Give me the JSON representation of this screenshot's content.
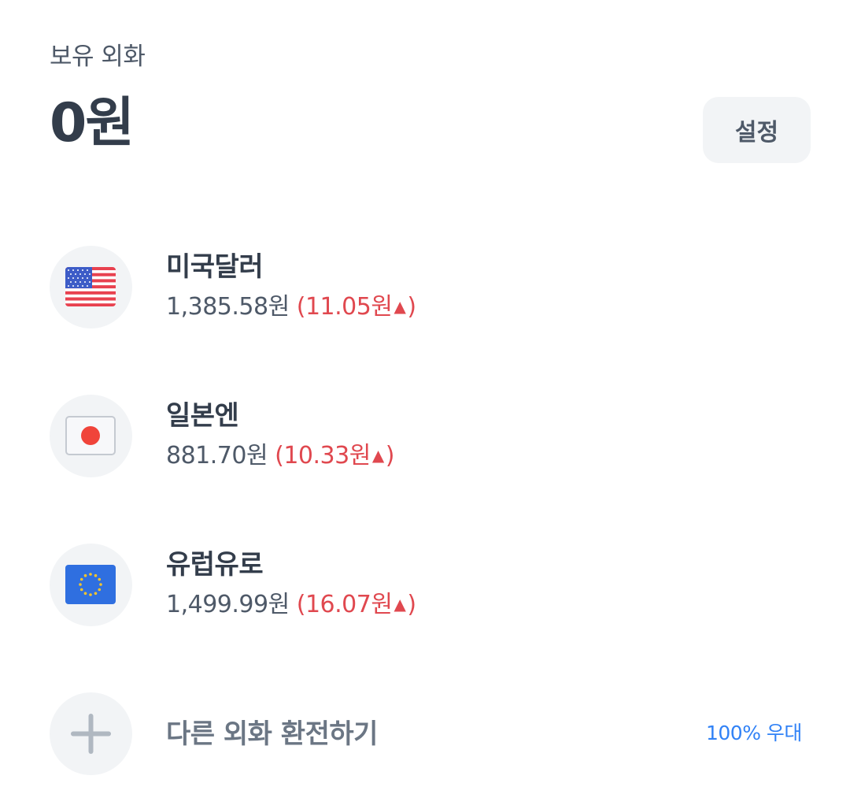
{
  "header": {
    "section_label": "보유 외화",
    "total_amount": "0원",
    "settings_label": "설정"
  },
  "currencies": [
    {
      "name": "미국달러",
      "rate": "1,385.58원",
      "change_open": "(11.05원",
      "change_arrow": "▲",
      "change_close": ")",
      "icon": "us-flag-icon"
    },
    {
      "name": "일본엔",
      "rate": "881.70원",
      "change_open": "(10.33원",
      "change_arrow": "▲",
      "change_close": ")",
      "icon": "japan-flag-icon"
    },
    {
      "name": "유럽유로",
      "rate": "1,499.99원",
      "change_open": "(16.07원",
      "change_arrow": "▲",
      "change_close": ")",
      "icon": "eu-flag-icon"
    }
  ],
  "add_row": {
    "label": "다른 외화 환전하기",
    "promo": "100% 우대",
    "icon": "plus-icon"
  },
  "colors": {
    "text_primary": "#333d4b",
    "text_secondary": "#4e5968",
    "change_up": "#e0484f",
    "accent_blue": "#3182f6",
    "circle_bg": "#f2f4f6"
  }
}
